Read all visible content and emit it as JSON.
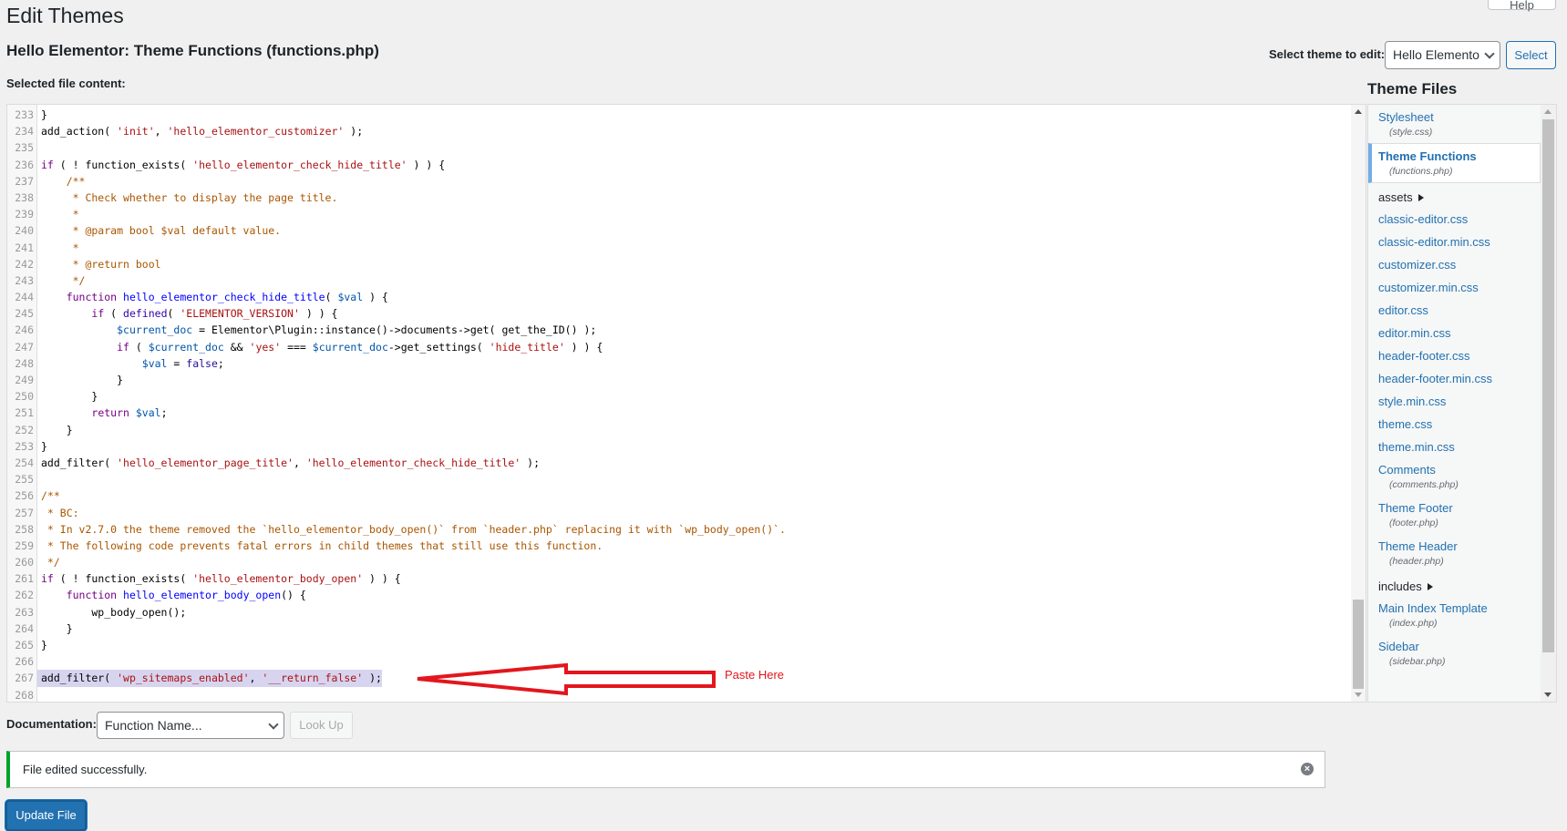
{
  "header": {
    "help_label": "Help",
    "title": "Edit Themes",
    "subtitle": "Hello Elementor: Theme Functions (functions.php)",
    "selected_file_label": "Selected file content:"
  },
  "theme_picker": {
    "label": "Select theme to edit:",
    "value": "Hello Elemento",
    "button": "Select"
  },
  "files": {
    "title": "Theme Files",
    "items": [
      {
        "kind": "file",
        "label": "Stylesheet",
        "file": "(style.css)"
      },
      {
        "kind": "file",
        "label": "Theme Functions",
        "file": "(functions.php)",
        "current": true
      },
      {
        "kind": "dir",
        "label": "assets"
      },
      {
        "kind": "file",
        "label": "classic-editor.css"
      },
      {
        "kind": "file",
        "label": "classic-editor.min.css"
      },
      {
        "kind": "file",
        "label": "customizer.css"
      },
      {
        "kind": "file",
        "label": "customizer.min.css"
      },
      {
        "kind": "file",
        "label": "editor.css"
      },
      {
        "kind": "file",
        "label": "editor.min.css"
      },
      {
        "kind": "file",
        "label": "header-footer.css"
      },
      {
        "kind": "file",
        "label": "header-footer.min.css"
      },
      {
        "kind": "file",
        "label": "style.min.css"
      },
      {
        "kind": "file",
        "label": "theme.css"
      },
      {
        "kind": "file",
        "label": "theme.min.css"
      },
      {
        "kind": "file",
        "label": "Comments",
        "file": "(comments.php)"
      },
      {
        "kind": "file",
        "label": "Theme Footer",
        "file": "(footer.php)"
      },
      {
        "kind": "file",
        "label": "Theme Header",
        "file": "(header.php)"
      },
      {
        "kind": "dir",
        "label": "includes"
      },
      {
        "kind": "file",
        "label": "Main Index Template",
        "file": "(index.php)"
      },
      {
        "kind": "file",
        "label": "Sidebar",
        "file": "(sidebar.php)"
      }
    ]
  },
  "colors": {
    "keyword": "#770088",
    "string": "#aa1111",
    "comment": "#aa5500",
    "variable": "#0055aa",
    "def": "#0000ff",
    "annotation": "#e3161d",
    "success": "#00a32a",
    "primary": "#2271b1"
  },
  "code": [
    {
      "n": "233",
      "t": [
        [
          "p",
          "}"
        ]
      ]
    },
    {
      "n": "234",
      "t": [
        [
          "p",
          "add_action( "
        ],
        [
          "s",
          "'init'"
        ],
        [
          "p",
          ", "
        ],
        [
          "s",
          "'hello_elementor_customizer'"
        ],
        [
          "p",
          " );"
        ]
      ]
    },
    {
      "n": "235",
      "t": []
    },
    {
      "n": "236",
      "t": [
        [
          "k",
          "if"
        ],
        [
          "p",
          " ( ! function_exists( "
        ],
        [
          "s",
          "'hello_elementor_check_hide_title'"
        ],
        [
          "p",
          " ) ) {"
        ]
      ]
    },
    {
      "n": "237",
      "t": [
        [
          "c",
          "    /**"
        ]
      ]
    },
    {
      "n": "238",
      "t": [
        [
          "c",
          "     * Check whether to display the page title."
        ]
      ]
    },
    {
      "n": "239",
      "t": [
        [
          "c",
          "     *"
        ]
      ]
    },
    {
      "n": "240",
      "t": [
        [
          "c",
          "     * @param bool $val default value."
        ]
      ]
    },
    {
      "n": "241",
      "t": [
        [
          "c",
          "     *"
        ]
      ]
    },
    {
      "n": "242",
      "t": [
        [
          "c",
          "     * @return bool"
        ]
      ]
    },
    {
      "n": "243",
      "t": [
        [
          "c",
          "     */"
        ]
      ]
    },
    {
      "n": "244",
      "t": [
        [
          "p",
          "    "
        ],
        [
          "k",
          "function"
        ],
        [
          "p",
          " "
        ],
        [
          "d",
          "hello_elementor_check_hide_title"
        ],
        [
          "p",
          "( "
        ],
        [
          "v",
          "$val"
        ],
        [
          "p",
          " ) {"
        ]
      ]
    },
    {
      "n": "245",
      "t": [
        [
          "p",
          "        "
        ],
        [
          "k",
          "if"
        ],
        [
          "p",
          " ( "
        ],
        [
          "b",
          "defined"
        ],
        [
          "p",
          "( "
        ],
        [
          "s",
          "'ELEMENTOR_VERSION'"
        ],
        [
          "p",
          " ) ) {"
        ]
      ]
    },
    {
      "n": "246",
      "t": [
        [
          "p",
          "            "
        ],
        [
          "v",
          "$current_doc"
        ],
        [
          "p",
          " = Elementor\\Plugin::instance()->documents->get( get_the_ID() );"
        ]
      ]
    },
    {
      "n": "247",
      "t": [
        [
          "p",
          "            "
        ],
        [
          "k",
          "if"
        ],
        [
          "p",
          " ( "
        ],
        [
          "v",
          "$current_doc"
        ],
        [
          "p",
          " && "
        ],
        [
          "s",
          "'yes'"
        ],
        [
          "p",
          " === "
        ],
        [
          "v",
          "$current_doc"
        ],
        [
          "p",
          "->get_settings( "
        ],
        [
          "s",
          "'hide_title'"
        ],
        [
          "p",
          " ) ) {"
        ]
      ]
    },
    {
      "n": "248",
      "t": [
        [
          "p",
          "                "
        ],
        [
          "v",
          "$val"
        ],
        [
          "p",
          " = "
        ],
        [
          "a",
          "false"
        ],
        [
          "p",
          ";"
        ]
      ]
    },
    {
      "n": "249",
      "t": [
        [
          "p",
          "            }"
        ]
      ]
    },
    {
      "n": "250",
      "t": [
        [
          "p",
          "        }"
        ]
      ]
    },
    {
      "n": "251",
      "t": [
        [
          "p",
          "        "
        ],
        [
          "k",
          "return"
        ],
        [
          "p",
          " "
        ],
        [
          "v",
          "$val"
        ],
        [
          "p",
          ";"
        ]
      ]
    },
    {
      "n": "252",
      "t": [
        [
          "p",
          "    }"
        ]
      ]
    },
    {
      "n": "253",
      "t": [
        [
          "p",
          "}"
        ]
      ]
    },
    {
      "n": "254",
      "t": [
        [
          "p",
          "add_filter( "
        ],
        [
          "s",
          "'hello_elementor_page_title'"
        ],
        [
          "p",
          ", "
        ],
        [
          "s",
          "'hello_elementor_check_hide_title'"
        ],
        [
          "p",
          " );"
        ]
      ]
    },
    {
      "n": "255",
      "t": []
    },
    {
      "n": "256",
      "t": [
        [
          "c",
          "/**"
        ]
      ]
    },
    {
      "n": "257",
      "t": [
        [
          "c",
          " * BC:"
        ]
      ]
    },
    {
      "n": "258",
      "t": [
        [
          "c",
          " * In v2.7.0 the theme removed the `hello_elementor_body_open()` from `header.php` replacing it with `wp_body_open()`."
        ]
      ]
    },
    {
      "n": "259",
      "t": [
        [
          "c",
          " * The following code prevents fatal errors in child themes that still use this function."
        ]
      ]
    },
    {
      "n": "260",
      "t": [
        [
          "c",
          " */"
        ]
      ]
    },
    {
      "n": "261",
      "t": [
        [
          "k",
          "if"
        ],
        [
          "p",
          " ( ! function_exists( "
        ],
        [
          "s",
          "'hello_elementor_body_open'"
        ],
        [
          "p",
          " ) ) {"
        ]
      ]
    },
    {
      "n": "262",
      "t": [
        [
          "p",
          "    "
        ],
        [
          "k",
          "function"
        ],
        [
          "p",
          " "
        ],
        [
          "d",
          "hello_elementor_body_open"
        ],
        [
          "p",
          "() {"
        ]
      ]
    },
    {
      "n": "263",
      "t": [
        [
          "p",
          "        wp_body_open();"
        ]
      ]
    },
    {
      "n": "264",
      "t": [
        [
          "p",
          "    }"
        ]
      ]
    },
    {
      "n": "265",
      "t": [
        [
          "p",
          "}"
        ]
      ]
    },
    {
      "n": "266",
      "t": []
    },
    {
      "n": "267",
      "t": [
        [
          "p",
          "add_filter( "
        ],
        [
          "s",
          "'wp_sitemaps_enabled'"
        ],
        [
          "p",
          ", "
        ],
        [
          "s",
          "'__return_false'"
        ],
        [
          "p",
          " );"
        ]
      ],
      "selected": true
    },
    {
      "n": "268",
      "t": []
    }
  ],
  "annotation": {
    "label": "Paste Here"
  },
  "documentation": {
    "label": "Documentation:",
    "select_value": "Function Name...",
    "lookup_button": "Look Up"
  },
  "notice": {
    "message": "File edited successfully.",
    "dismiss": "×"
  },
  "update_button": "Update File"
}
